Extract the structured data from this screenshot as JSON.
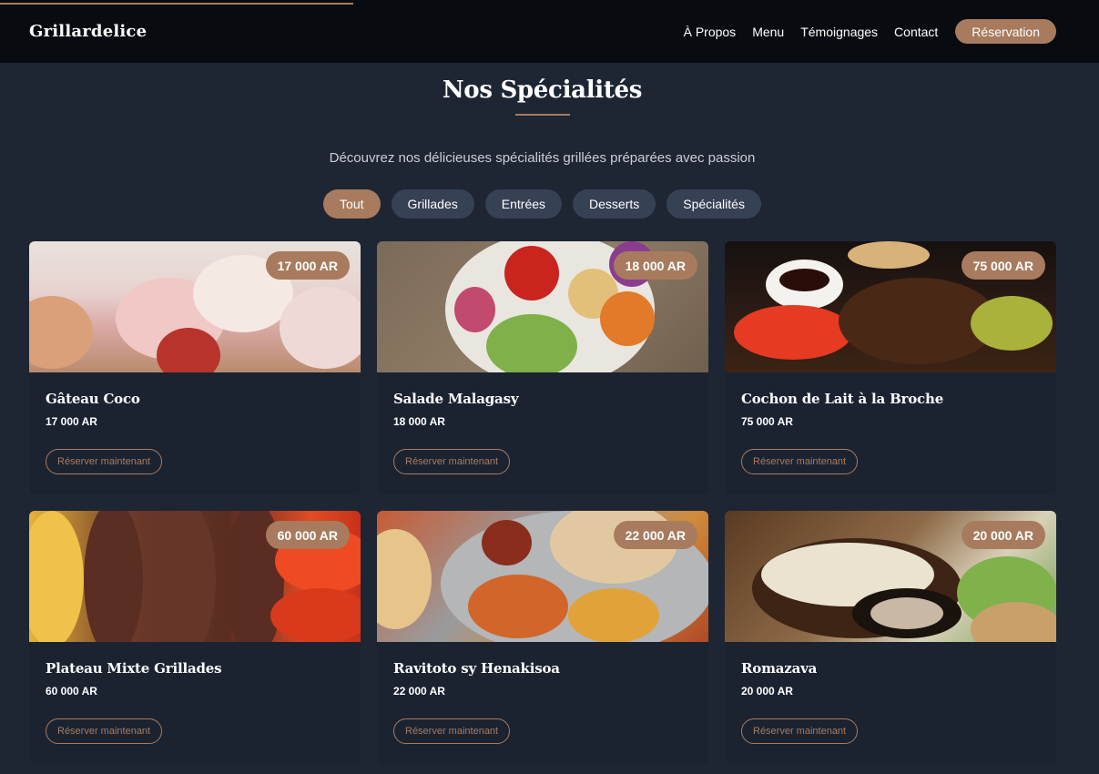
{
  "header": {
    "logo": "Grillardelice",
    "nav": [
      "À Propos",
      "Menu",
      "Témoignages",
      "Contact"
    ],
    "cta": "Réservation"
  },
  "section": {
    "title": "Nos Spécialités",
    "subtitle": "Découvrez nos délicieuses spécialités grillées préparées avec passion"
  },
  "filters": {
    "items": [
      "Tout",
      "Grillades",
      "Entrées",
      "Desserts",
      "Spécialités"
    ],
    "active": "Tout"
  },
  "cards": [
    {
      "name": "Gâteau Coco",
      "price": "17 000 AR",
      "badge": "17 000 AR",
      "button": "Réserver maintenant"
    },
    {
      "name": "Salade Malagasy",
      "price": "18 000 AR",
      "badge": "18 000 AR",
      "button": "Réserver maintenant"
    },
    {
      "name": "Cochon de Lait à la Broche",
      "price": "75 000 AR",
      "badge": "75 000 AR",
      "button": "Réserver maintenant"
    },
    {
      "name": "Plateau Mixte Grillades",
      "price": "60 000 AR",
      "badge": "60 000 AR",
      "button": "Réserver maintenant"
    },
    {
      "name": "Ravitoto sy Henakisoa",
      "price": "22 000 AR",
      "badge": "22 000 AR",
      "button": "Réserver maintenant"
    },
    {
      "name": "Romazava",
      "price": "20 000 AR",
      "badge": "20 000 AR",
      "button": "Réserver maintenant"
    }
  ],
  "colors": {
    "accent": "#a87b5f",
    "header_bg": "#080b10",
    "page_bg": "#1e2634",
    "card_bg": "#1b2331",
    "filter_bg": "#364154"
  }
}
